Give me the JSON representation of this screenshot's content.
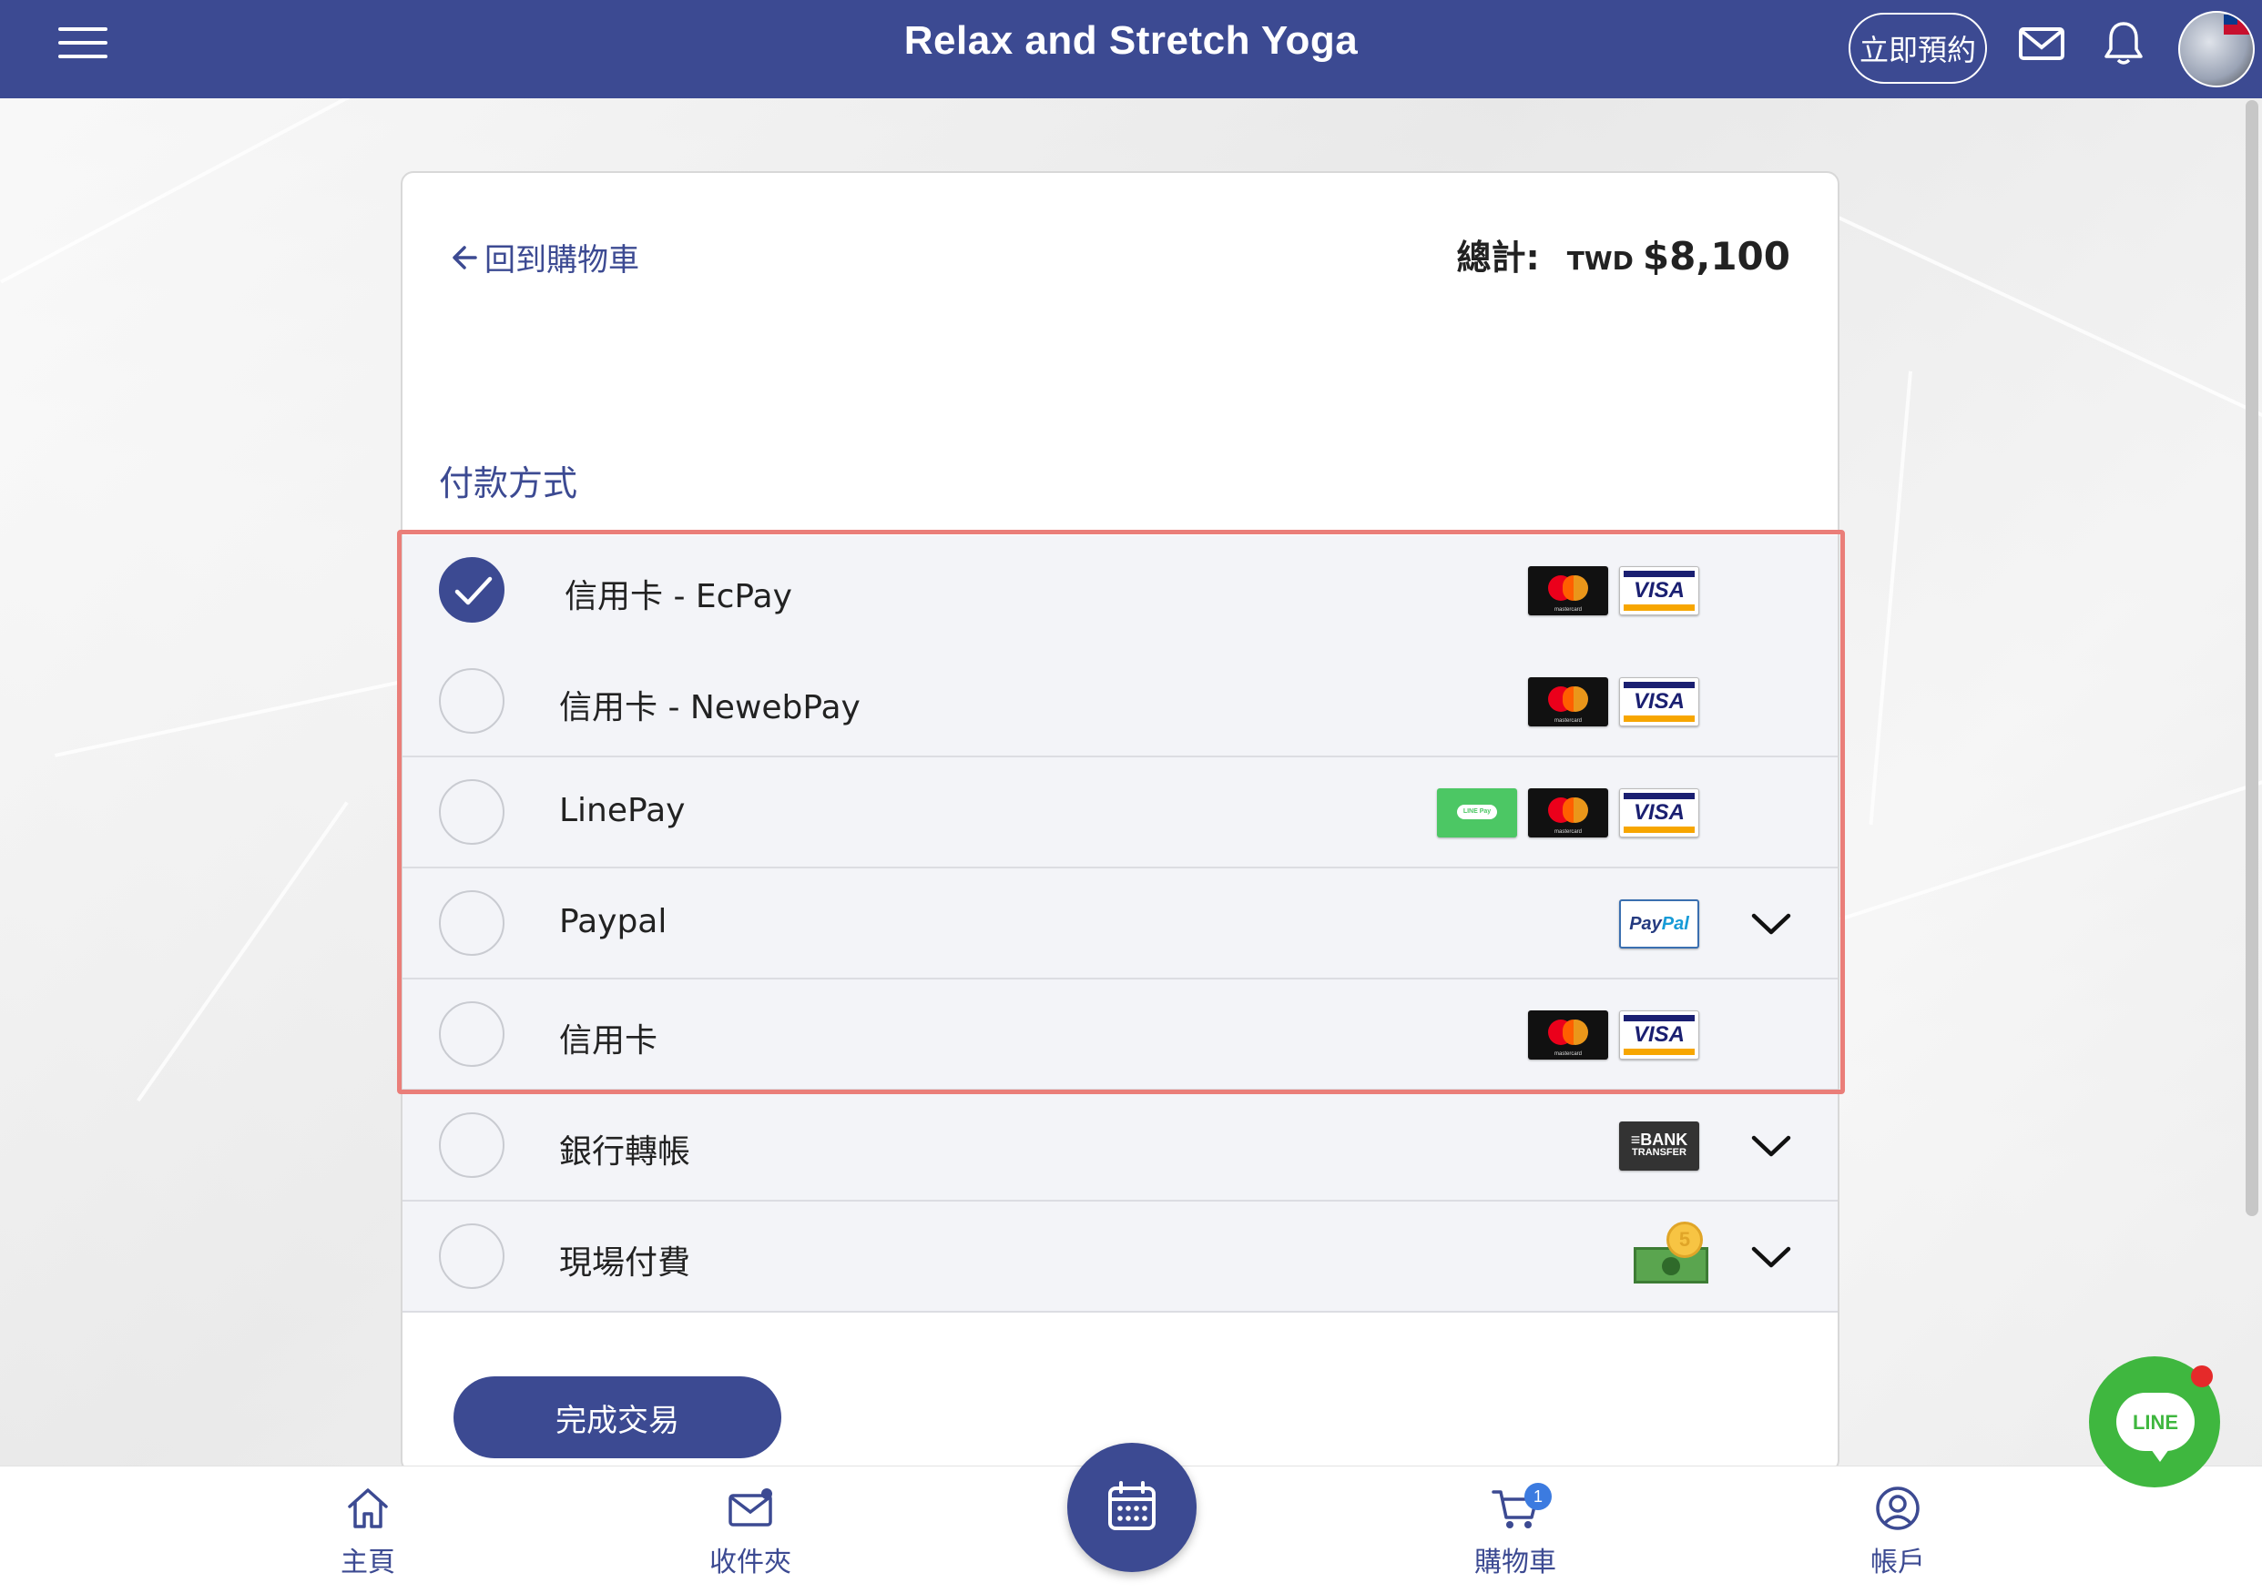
{
  "app": {
    "title": "Relax and Stretch Yoga",
    "book_label": "立即預約"
  },
  "checkout": {
    "back_label": "回到購物車",
    "total_label": "總計:",
    "currency": "TWD",
    "total_value": "$8,100",
    "section_title": "付款方式",
    "methods": [
      {
        "label": "信用卡 - EcPay",
        "selected": true,
        "logos": [
          "mastercard-icon",
          "visa-icon"
        ],
        "expandable": false
      },
      {
        "label": "信用卡 - NewebPay",
        "selected": false,
        "logos": [
          "mastercard-icon",
          "visa-icon"
        ],
        "expandable": false
      },
      {
        "label": "LinePay",
        "selected": false,
        "logos": [
          "linepay-icon",
          "mastercard-icon",
          "visa-icon"
        ],
        "expandable": false
      },
      {
        "label": "Paypal",
        "selected": false,
        "logos": [
          "paypal-icon"
        ],
        "expandable": true
      },
      {
        "label": "信用卡",
        "selected": false,
        "logos": [
          "mastercard-icon",
          "visa-icon"
        ],
        "expandable": false
      },
      {
        "label": "銀行轉帳",
        "selected": false,
        "logos": [
          "bank-transfer-icon"
        ],
        "expandable": true
      },
      {
        "label": "現場付費",
        "selected": false,
        "logos": [
          "cash-icon"
        ],
        "expandable": true
      }
    ],
    "logo_text": {
      "visa": "VISA",
      "mastercard": "mastercard",
      "linepay": "LINE Pay",
      "paypal_a": "Pay",
      "paypal_b": "Pal",
      "bank_1": "≡BANK",
      "bank_2": "TRANSFER",
      "coin": "5"
    },
    "complete_label": "完成交易"
  },
  "bottom_nav": {
    "home": "主頁",
    "inbox": "收件夾",
    "cart": "購物車",
    "cart_count": "1",
    "account": "帳戶"
  },
  "line_chat": {
    "label": "LINE"
  },
  "colors": {
    "brand": "#3c4a92",
    "highlight": "#ea7e79",
    "line_green": "#3fb73f"
  }
}
